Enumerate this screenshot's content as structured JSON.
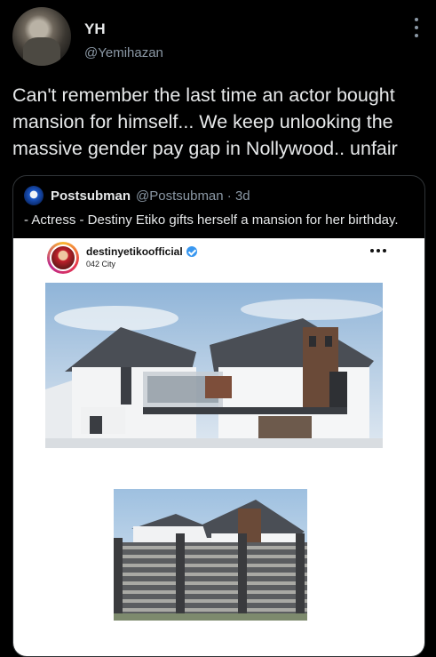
{
  "tweet": {
    "author_name": "YH",
    "author_handle": "@Yemihazan",
    "text": "Can't remember the last time an actor bought mansion for himself... We keep unlooking the massive gender pay gap in Nollywood.. unfair"
  },
  "quoted": {
    "author_name": "Postsubman",
    "author_handle": "@Postsubman · 3d",
    "text": "- Actress - Destiny Etiko gifts herself a mansion for her birthday."
  },
  "instagram_post": {
    "username": "destinyetikoofficial",
    "location": "042 City"
  },
  "icons": {
    "more": "more-vertical-icon",
    "ig_more": "more-horizontal-icon",
    "verified": "verified-badge-icon"
  },
  "colors": {
    "background": "#000000",
    "primary_text": "#e7e9ea",
    "secondary_text": "#8b98a5",
    "verified_blue": "#3897f0"
  }
}
